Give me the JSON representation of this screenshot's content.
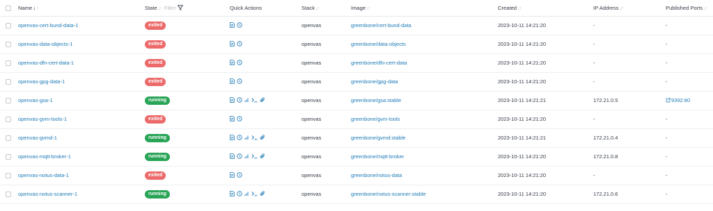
{
  "columns": {
    "name": "Name",
    "state": "State",
    "filter": "Filter",
    "quick_actions": "Quick Actions",
    "stack": "Stack",
    "image": "Image",
    "created": "Created",
    "ip": "IP Address",
    "ports": "Published Ports"
  },
  "quick_action_icons": {
    "stopped": [
      "logs-icon",
      "inspect-icon"
    ],
    "running": [
      "logs-icon",
      "inspect-icon",
      "stats-icon",
      "console-icon",
      "attach-icon"
    ]
  },
  "colors": {
    "exited": "#ec6a6a",
    "running": "#28a456",
    "link": "#1d7ab6"
  },
  "rows": [
    {
      "name": "openvas-cert-bund-data-1",
      "state": "exited",
      "stack": "openvas",
      "image": "greenbone/cert-bund-data",
      "created": "2023-10-11 14:21:20",
      "ip": "-",
      "port": "-"
    },
    {
      "name": "openvas-data-objects-1",
      "state": "exited",
      "stack": "openvas",
      "image": "greenbone/data-objects",
      "created": "2023-10-11 14:21:20",
      "ip": "-",
      "port": "-"
    },
    {
      "name": "openvas-dfn-cert-data-1",
      "state": "exited",
      "stack": "openvas",
      "image": "greenbone/dfn-cert-data",
      "created": "2023-10-11 14:21:20",
      "ip": "-",
      "port": "-"
    },
    {
      "name": "openvas-gpg-data-1",
      "state": "exited",
      "stack": "openvas",
      "image": "greenbone/gpg-data",
      "created": "2023-10-11 14:21:20",
      "ip": "-",
      "port": "-"
    },
    {
      "name": "openvas-gsa-1",
      "state": "running",
      "stack": "openvas",
      "image": "greenbone/gsa:stable",
      "created": "2023-10-11 14:21:21",
      "ip": "172.21.0.5",
      "port": "9392:80"
    },
    {
      "name": "openvas-gvm-tools-1",
      "state": "exited",
      "stack": "openvas",
      "image": "greenbone/gvm-tools",
      "created": "2023-10-11 14:21:20",
      "ip": "-",
      "port": "-"
    },
    {
      "name": "openvas-gvmd-1",
      "state": "running",
      "stack": "openvas",
      "image": "greenbone/gvmd:stable",
      "created": "2023-10-11 14:21:21",
      "ip": "172.21.0.4",
      "port": "-"
    },
    {
      "name": "openvas-mqtt-broker-1",
      "state": "running",
      "stack": "openvas",
      "image": "greenbone/mqtt-broker",
      "created": "2023-10-11 14:21:20",
      "ip": "172.21.0.8",
      "port": "-"
    },
    {
      "name": "openvas-notus-data-1",
      "state": "exited",
      "stack": "openvas",
      "image": "greenbone/notus-data",
      "created": "2023-10-11 14:21:20",
      "ip": "-",
      "port": "-"
    },
    {
      "name": "openvas-notus-scanner-1",
      "state": "running",
      "stack": "openvas",
      "image": "greenbone/notus-scanner:stable",
      "created": "2023-10-11 14:21:20",
      "ip": "172.21.0.6",
      "port": "-"
    }
  ]
}
